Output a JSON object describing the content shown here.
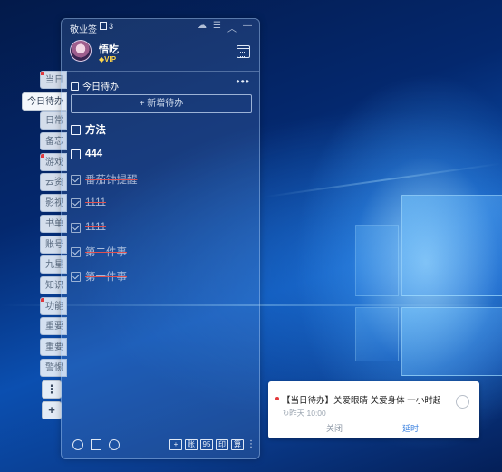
{
  "app": {
    "name": "敬业签",
    "badge_count": "3"
  },
  "user": {
    "name": "悟吃",
    "vip_label": "VIP"
  },
  "side_tabs": [
    "当日",
    "日常",
    "备忘",
    "游戏",
    "云资",
    "影视",
    "书单",
    "账号",
    "九星",
    "知识",
    "功能",
    "重要",
    "重要",
    "警惕"
  ],
  "active_tab": "今日待办",
  "section": {
    "title": "今日待办",
    "more": "•••"
  },
  "add_button": "+ 新增待办",
  "todos": [
    {
      "text": "方法",
      "done": false
    },
    {
      "text": "444",
      "done": false
    },
    {
      "text": "番茄钟提醒",
      "done": true
    },
    {
      "text": "1111",
      "done": true
    },
    {
      "text": "1111",
      "done": true
    },
    {
      "text": "第二件事",
      "done": true
    },
    {
      "text": "第一件事",
      "done": true
    }
  ],
  "bottom_tools": [
    "+",
    "账",
    "95",
    "印",
    "算"
  ],
  "side_buttons": {
    "more": "⋮",
    "add": "+"
  },
  "notification": {
    "text": "【当日待办】关爱眼睛 关爱身体 一小时起身",
    "time": "昨天 10:00",
    "close_label": "关闭",
    "delay_label": "延时"
  }
}
